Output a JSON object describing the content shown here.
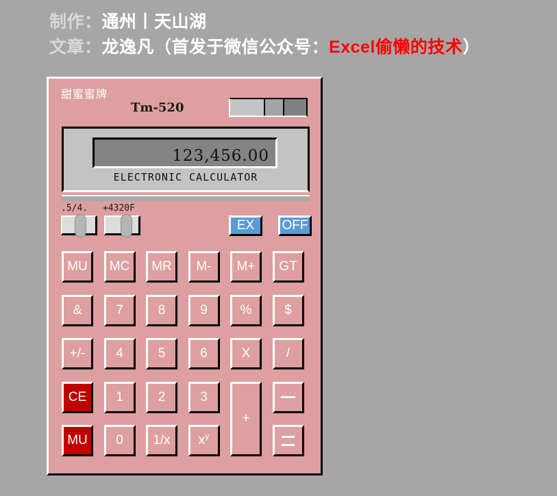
{
  "credits": {
    "line1_label": "制作：",
    "line1_value": "通州丨天山湖",
    "line2_label": "文章：",
    "line2_value_pre": "龙逸凡（首发于微信公众号：",
    "line2_highlight": "Excel偷懒的技术",
    "line2_value_post": "）"
  },
  "calculator": {
    "brand": "甜蜜蜜牌",
    "model": "Tm-520",
    "display_value": "123,456.00",
    "display_caption": "ELECTRONIC  CALCULATOR",
    "switches": [
      {
        "label": ".5/4.",
        "name": "rounding-switch"
      },
      {
        "label": "+4320F",
        "name": "decimal-switch"
      }
    ],
    "top_buttons": [
      {
        "label": "EX",
        "name": "ex-button"
      },
      {
        "label": "OFF",
        "name": "off-button"
      }
    ],
    "keys": [
      {
        "label": "MU",
        "name": "key-mu-top",
        "col": 0,
        "row": 0,
        "style": "normal"
      },
      {
        "label": "MC",
        "name": "key-mc",
        "col": 1,
        "row": 0,
        "style": "normal"
      },
      {
        "label": "MR",
        "name": "key-mr",
        "col": 2,
        "row": 0,
        "style": "normal"
      },
      {
        "label": "M-",
        "name": "key-m-minus",
        "col": 3,
        "row": 0,
        "style": "normal"
      },
      {
        "label": "M+",
        "name": "key-m-plus",
        "col": 4,
        "row": 0,
        "style": "normal"
      },
      {
        "label": "GT",
        "name": "key-gt",
        "col": 5,
        "row": 0,
        "style": "normal"
      },
      {
        "label": "&",
        "name": "key-ampersand",
        "col": 0,
        "row": 1,
        "style": "normal"
      },
      {
        "label": "7",
        "name": "key-7",
        "col": 1,
        "row": 1,
        "style": "normal"
      },
      {
        "label": "8",
        "name": "key-8",
        "col": 2,
        "row": 1,
        "style": "normal"
      },
      {
        "label": "9",
        "name": "key-9",
        "col": 3,
        "row": 1,
        "style": "normal"
      },
      {
        "label": "%",
        "name": "key-percent",
        "col": 4,
        "row": 1,
        "style": "normal"
      },
      {
        "label": "$",
        "name": "key-dollar",
        "col": 5,
        "row": 1,
        "style": "normal"
      },
      {
        "label": "+/-",
        "name": "key-sign-toggle",
        "col": 0,
        "row": 2,
        "style": "normal"
      },
      {
        "label": "4",
        "name": "key-4",
        "col": 1,
        "row": 2,
        "style": "normal"
      },
      {
        "label": "5",
        "name": "key-5",
        "col": 2,
        "row": 2,
        "style": "normal"
      },
      {
        "label": "6",
        "name": "key-6",
        "col": 3,
        "row": 2,
        "style": "normal"
      },
      {
        "label": "X",
        "name": "key-multiply",
        "col": 4,
        "row": 2,
        "style": "normal"
      },
      {
        "label": "/",
        "name": "key-divide",
        "col": 5,
        "row": 2,
        "style": "normal"
      },
      {
        "label": "CE",
        "name": "key-ce",
        "col": 0,
        "row": 3,
        "style": "red"
      },
      {
        "label": "1",
        "name": "key-1",
        "col": 1,
        "row": 3,
        "style": "normal"
      },
      {
        "label": "2",
        "name": "key-2",
        "col": 2,
        "row": 3,
        "style": "normal"
      },
      {
        "label": "3",
        "name": "key-3",
        "col": 3,
        "row": 3,
        "style": "normal"
      },
      {
        "label": "MU",
        "name": "key-mu-bottom",
        "col": 0,
        "row": 4,
        "style": "red"
      },
      {
        "label": "0",
        "name": "key-0",
        "col": 1,
        "row": 4,
        "style": "normal"
      },
      {
        "label": "1/x",
        "name": "key-reciprocal",
        "col": 2,
        "row": 4,
        "style": "normal"
      },
      {
        "label": "x^y",
        "name": "key-power",
        "col": 3,
        "row": 4,
        "style": "power"
      }
    ],
    "tall_key": {
      "label": "+",
      "name": "key-plus"
    },
    "minus_key": {
      "label": "—",
      "name": "key-minus"
    },
    "equals_key": {
      "label": "=",
      "name": "key-equals"
    }
  },
  "colors": {
    "background": "#a6a6a6",
    "body": "#dd9f9f",
    "accent_blue": "#5b9bd5",
    "accent_red": "#c00000",
    "highlight_text": "#ff0000",
    "display_screen": "#848484",
    "display_panel": "#c3c3c3"
  }
}
